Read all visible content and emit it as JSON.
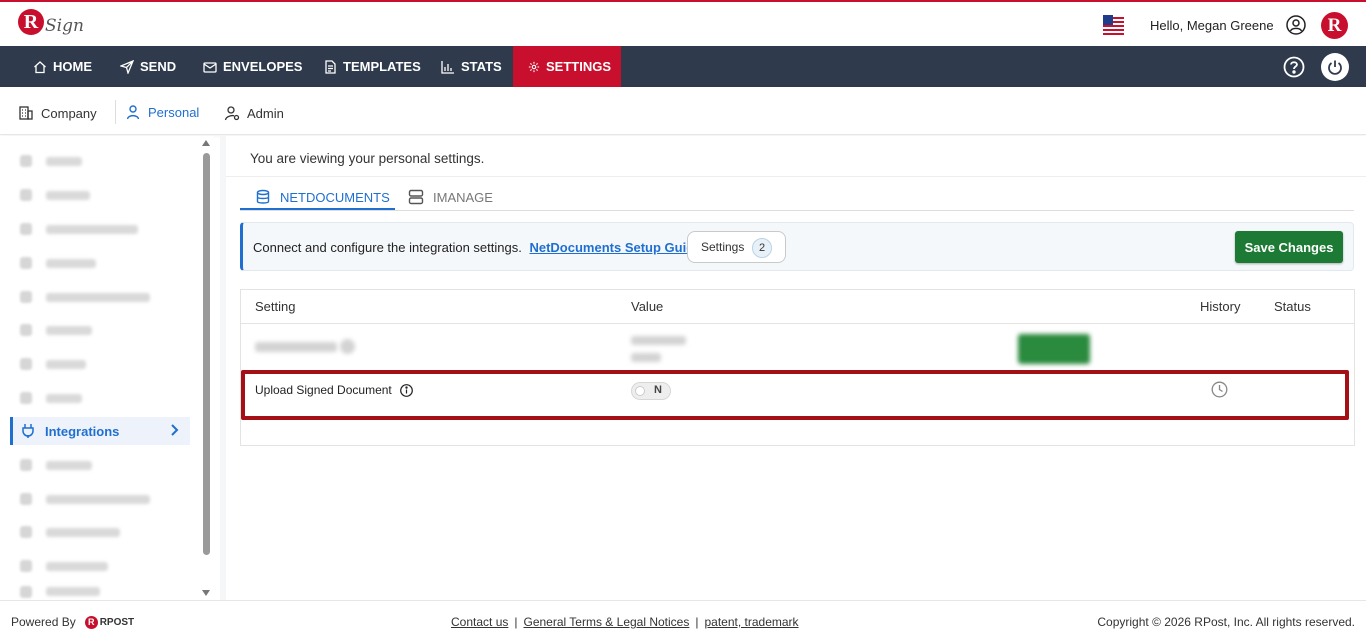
{
  "header": {
    "logo_letter": "R",
    "logo_sign": "Sign",
    "greeting": "Hello, Megan Greene",
    "brand_letter": "R",
    "brand_color": "#c8102e"
  },
  "nav": {
    "items": [
      {
        "label": "HOME",
        "icon": "home-icon"
      },
      {
        "label": "SEND",
        "icon": "send-icon"
      },
      {
        "label": "ENVELOPES",
        "icon": "envelope-icon"
      },
      {
        "label": "TEMPLATES",
        "icon": "template-icon"
      },
      {
        "label": "STATS",
        "icon": "stats-icon"
      },
      {
        "label": "SETTINGS",
        "icon": "gear-icon",
        "active": true
      }
    ],
    "bg_color": "#2f3b4c",
    "active_color": "#c8102e"
  },
  "subtabs": {
    "company": "Company",
    "personal": "Personal",
    "admin": "Admin",
    "active": "Personal"
  },
  "sidebar": {
    "active_item": "Integrations"
  },
  "main": {
    "title": "You are viewing your personal settings.",
    "tabs": [
      {
        "label": "NETDOCUMENTS",
        "icon": "database-icon",
        "active": true
      },
      {
        "label": "IMANAGE",
        "icon": "server-icon",
        "active": false
      }
    ],
    "info": {
      "text": "Connect and configure the integration settings.",
      "link": "NetDocuments Setup Guide",
      "settings_label": "Settings",
      "settings_count": "2"
    },
    "save_label": "Save Changes",
    "table": {
      "headers": {
        "setting": "Setting",
        "value": "Value",
        "history": "History",
        "status": "Status"
      },
      "rows": [
        {
          "setting": "Upload Signed Document",
          "value": "N"
        }
      ]
    }
  },
  "footer": {
    "powered_by": "Powered By",
    "rpost_letter": "R",
    "rpost": "RPOST",
    "links": [
      "Contact us",
      "General Terms & Legal Notices",
      "patent, trademark"
    ],
    "copyright": "Copyright © 2026 RPost, Inc. All rights reserved."
  }
}
